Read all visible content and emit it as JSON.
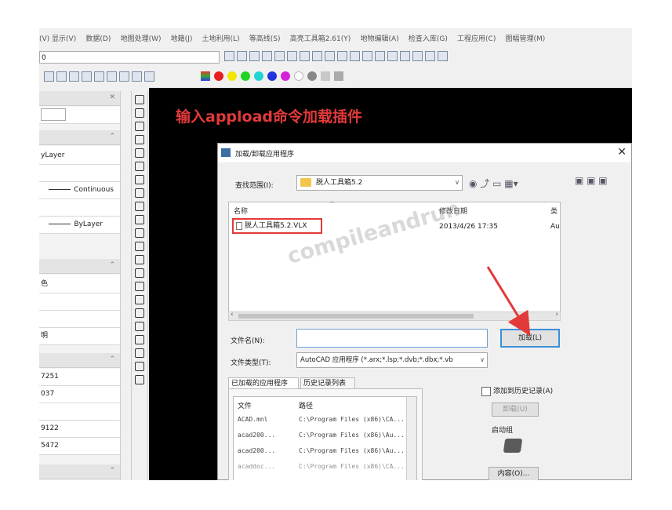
{
  "menu": [
    "(V) 显示(V)",
    "数据(D)",
    "地图处理(W)",
    "地籍(J)",
    "土地利用(L)",
    "等高线(S)",
    "高亮工具箱2.61(Y)",
    "地物编辑(A)",
    "检查入库(G)",
    "工程应用(C)",
    "图幅管理(M)"
  ],
  "layer_value": "0",
  "palette": {
    "rows": [
      "yLayer",
      "Continuous",
      "ByLayer",
      "色",
      "明",
      "7251",
      "037",
      "9122",
      "5472"
    ]
  },
  "caption": "输入appload命令加载插件",
  "dialog": {
    "title": "加载/卸载应用程序",
    "look_in_label": "查找范围(I):",
    "look_in_value": "脱人工具箱5.2",
    "col_name": "名称",
    "col_date": "修改日期",
    "col_type": "类",
    "file_name": "脱人工具箱5.2.VLX",
    "file_date": "2013/4/26 17:35",
    "file_type": "Au",
    "filename_label": "文件名(N):",
    "filename_value": "",
    "filetype_label": "文件类型(T):",
    "filetype_value": "AutoCAD 应用程序 (*.arx;*.lsp;*.dvb;*.dbx;*.vb",
    "load_button": "加载(L)",
    "tab_loaded": "已加载的应用程序",
    "tab_history": "历史记录列表",
    "add_history": "添加到历史记录(A)",
    "unload_button": "卸载(U)",
    "startup_label": "启动组",
    "contents_button": "内容(O)...",
    "loaded_header_file": "文件",
    "loaded_header_path": "路径",
    "loaded_rows": [
      {
        "file": "ACAD.mnl",
        "path": "C:\\Program Files (x86)\\CA..."
      },
      {
        "file": "acad200...",
        "path": "C:\\Program Files (x86)\\Au..."
      },
      {
        "file": "acad200...",
        "path": "C:\\Program Files (x86)\\Au..."
      },
      {
        "file": "acaddoc...",
        "path": "C:\\Program Files (x86)\\CA..."
      }
    ]
  },
  "watermark": "compileandrun",
  "colors": {
    "caption": "#e23a3a",
    "highlight": "#e23a3a",
    "canvas": "#000000",
    "button_focus": "#3c8fd8"
  }
}
